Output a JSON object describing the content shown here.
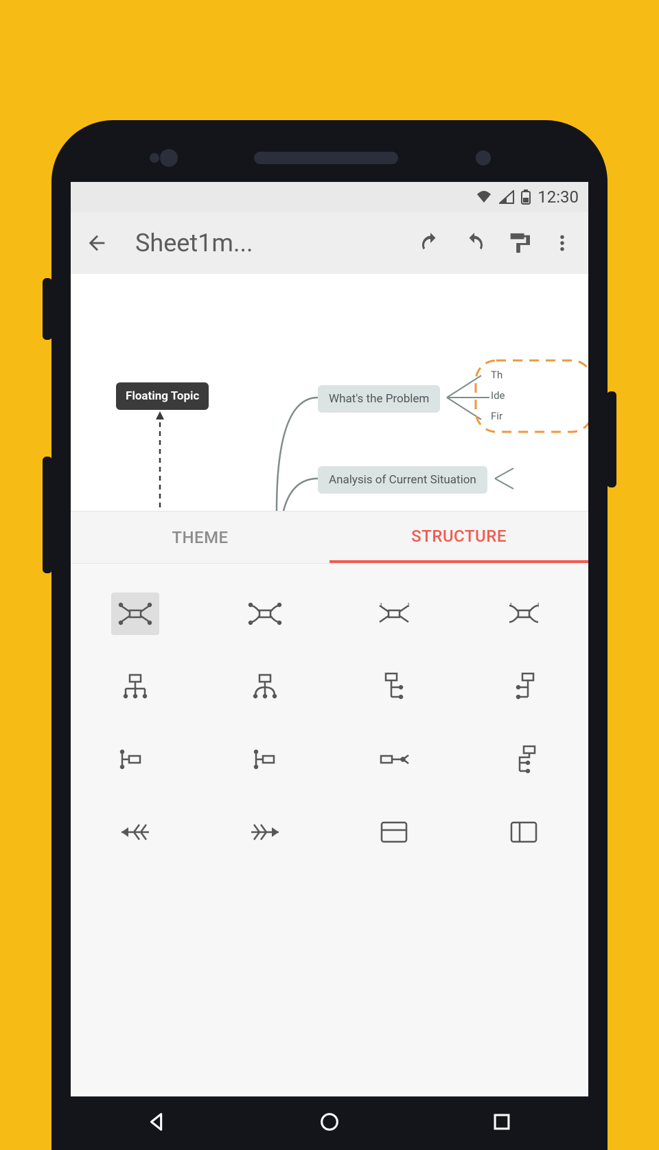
{
  "status": {
    "time": "12:30"
  },
  "appbar": {
    "title": "Sheet1m..."
  },
  "canvas": {
    "floating_topic": "Floating Topic",
    "node1": "What's the Problem",
    "node2": "Analysis of Current Situation",
    "leaf1": "Th",
    "leaf2": "Ide",
    "leaf3": "Fir"
  },
  "tabs": {
    "theme": "THEME",
    "structure": "STRUCTURE",
    "active": "structure"
  },
  "structures": [
    {
      "id": "balance-map",
      "selected": true
    },
    {
      "id": "balance-map-clockwise",
      "selected": false
    },
    {
      "id": "balance-map-ordered-1",
      "selected": false
    },
    {
      "id": "balance-map-ordered-2",
      "selected": false
    },
    {
      "id": "org-chart-down",
      "selected": false
    },
    {
      "id": "org-chart-down-alt",
      "selected": false
    },
    {
      "id": "tree-right",
      "selected": false
    },
    {
      "id": "tree-right-alt",
      "selected": false
    },
    {
      "id": "logic-right",
      "selected": false
    },
    {
      "id": "logic-right-alt",
      "selected": false
    },
    {
      "id": "logic-right-2",
      "selected": false
    },
    {
      "id": "tree-down",
      "selected": false
    },
    {
      "id": "fishbone-left",
      "selected": false
    },
    {
      "id": "fishbone-right",
      "selected": false
    },
    {
      "id": "spreadsheet-rows",
      "selected": false
    },
    {
      "id": "spreadsheet-cols",
      "selected": false
    }
  ]
}
